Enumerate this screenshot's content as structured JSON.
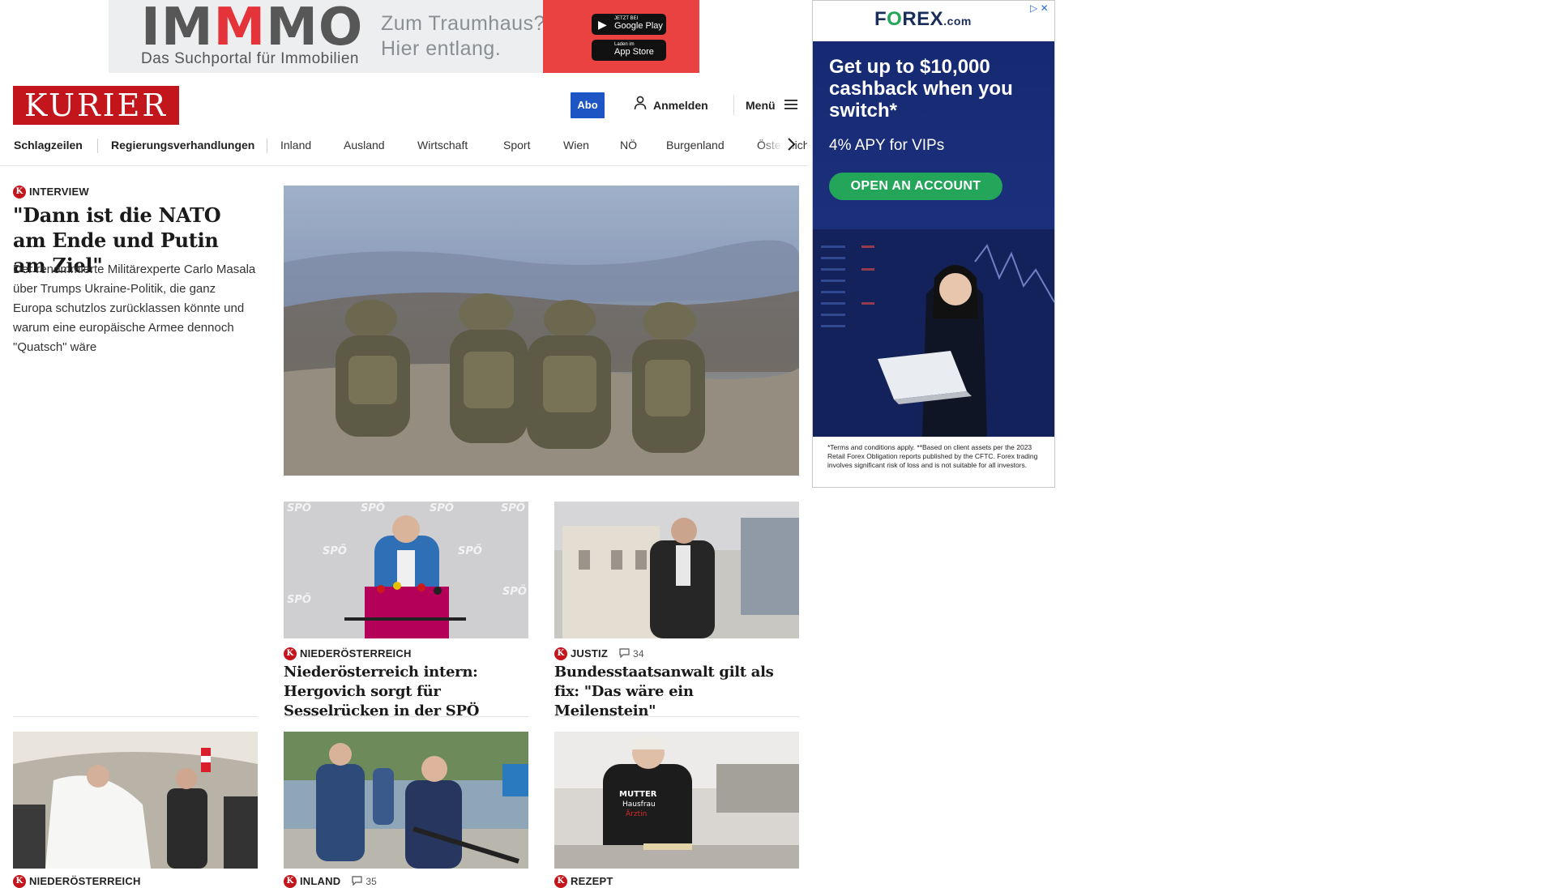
{
  "top_ad": {
    "logo_pre": "IM",
    "logo_m": "M",
    "logo_post": "MO",
    "subtitle": "Das Suchportal für Immobilien",
    "tagline_1": "Zum Traumhaus?",
    "tagline_2": "Hier entlang.",
    "google_play_small": "JETZT BEI",
    "google_play": "Google Play",
    "app_store_small": "Laden im",
    "app_store": "App Store"
  },
  "header": {
    "logo": "KURIER",
    "abo": "Abo",
    "login": "Anmelden",
    "menu": "Menü"
  },
  "nav": {
    "items": [
      "Schlagzeilen",
      "Regierungsverhandlungen",
      "Inland",
      "Ausland",
      "Wirtschaft",
      "Sport",
      "Wien",
      "NÖ",
      "Burgenland",
      "Österreich"
    ]
  },
  "lead": {
    "kicker": "INTERVIEW",
    "title": "\"Dann ist die NATO am Ende und Putin am Ziel\"",
    "teaser": "Der renommierte Militärexperte Carlo Masala über Trumps Ukraine-Politik, die ganz Europa schutzlos zurücklassen könnte und warum eine europäische Armee dennoch \"Quatsch\" wäre"
  },
  "cards": [
    {
      "kicker": "NIEDERÖSTERREICH",
      "comments": "",
      "title": "Niederösterreich intern: Hergovich sorgt für Sesselrücken in der SPÖ",
      "img_text": "SPÖ"
    },
    {
      "kicker": "JUSTIZ",
      "comments": "34",
      "title": "Bundesstaatsanwalt gilt als fix: \"Das wäre ein Meilenstein\""
    }
  ],
  "bottom_cards": [
    {
      "kicker": "NIEDERÖSTERREICH"
    },
    {
      "kicker": "INLAND",
      "comments": "35"
    },
    {
      "kicker": "REZEPT",
      "shirt_1": "MUTTER",
      "shirt_2": "Hausfrau",
      "shirt_3": "Ärztin"
    }
  ],
  "forex_ad": {
    "logo_pre": "F",
    "logo_o": "O",
    "logo_post": "REX",
    "logo_com": ".com",
    "headline": "Get up to $10,000 cashback when you switch*",
    "apy": "4% APY for VIPs",
    "cta": "OPEN AN ACCOUNT",
    "terms": "*Terms and conditions apply. **Based on client assets per the 2023 Retail Forex Obligation reports published by the CFTC. Forex trading involves significant risk of loss and is not suitable for all investors."
  },
  "colors": {
    "brand_red": "#c3161c",
    "abo_blue": "#1d55c4",
    "forex_navy": "#1b2f7c",
    "forex_green": "#23a55a",
    "immo_red": "#ea4141"
  }
}
